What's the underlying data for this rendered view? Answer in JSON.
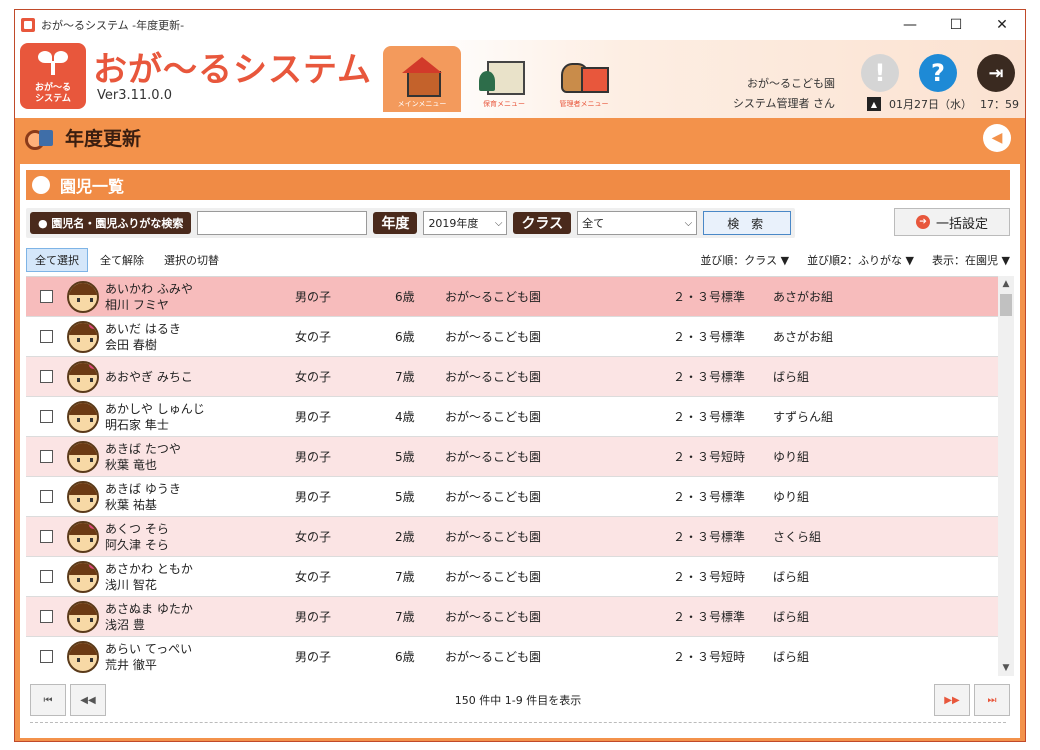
{
  "window": {
    "title": "おが～るシステム -年度更新-",
    "min": "—",
    "max": "☐",
    "close": "✕"
  },
  "header": {
    "logo_text": "おが～る\nシステム",
    "brand": "おが～るシステム",
    "version": "Ver3.11.0.0",
    "menus": [
      {
        "label": "メインメニュー",
        "icon": "house-icon"
      },
      {
        "label": "保育メニュー",
        "icon": "board-icon"
      },
      {
        "label": "管理者メニュー",
        "icon": "cat-icon"
      }
    ],
    "org": "おが～るこども園",
    "user": "システム管理者 さん",
    "date": "01月27日（水）",
    "time": "17：59"
  },
  "section": {
    "title": "年度更新"
  },
  "list": {
    "title": "園児一覧",
    "search_label": "● 園児名・園児ふりがな検索",
    "search_value": "",
    "year_label": "年度",
    "year_value": "2019年度",
    "class_label": "クラス",
    "class_value": "全て",
    "search_button": "検 索",
    "bulk_button": "一括設定"
  },
  "toolbar": {
    "select_all": "全て選択",
    "deselect_all": "全て解除",
    "toggle": "選択の切替",
    "sort1": "並び順：クラス ▼",
    "sort2": "並び順2：ふりがな ▼",
    "display": "表示：在園児 ▼"
  },
  "rows": [
    {
      "kana": "あいかわ ふみや",
      "kanji": "相川 フミヤ",
      "sex": "男の子",
      "age": "6歳",
      "org": "おが～るこども園",
      "std": "２・３号標準",
      "cls": "あさがお組",
      "girl": false
    },
    {
      "kana": "あいだ はるき",
      "kanji": "会田 春樹",
      "sex": "女の子",
      "age": "6歳",
      "org": "おが～るこども園",
      "std": "２・３号標準",
      "cls": "あさがお組",
      "girl": true
    },
    {
      "kana": "あおやぎ みちこ",
      "kanji": "",
      "sex": "女の子",
      "age": "7歳",
      "org": "おが～るこども園",
      "std": "２・３号標準",
      "cls": "ばら組",
      "girl": true
    },
    {
      "kana": "あかしや しゅんじ",
      "kanji": "明石家 隼士",
      "sex": "男の子",
      "age": "4歳",
      "org": "おが～るこども園",
      "std": "２・３号標準",
      "cls": "すずらん組",
      "girl": false
    },
    {
      "kana": "あきば たつや",
      "kanji": "秋葉 竜也",
      "sex": "男の子",
      "age": "5歳",
      "org": "おが～るこども園",
      "std": "２・３号短時",
      "cls": "ゆり組",
      "girl": false
    },
    {
      "kana": "あきば ゆうき",
      "kanji": "秋葉 祐基",
      "sex": "男の子",
      "age": "5歳",
      "org": "おが～るこども園",
      "std": "２・３号標準",
      "cls": "ゆり組",
      "girl": false
    },
    {
      "kana": "あくつ そら",
      "kanji": "阿久津 そら",
      "sex": "女の子",
      "age": "2歳",
      "org": "おが～るこども園",
      "std": "２・３号標準",
      "cls": "さくら組",
      "girl": true
    },
    {
      "kana": "あさかわ ともか",
      "kanji": "浅川 智花",
      "sex": "女の子",
      "age": "7歳",
      "org": "おが～るこども園",
      "std": "２・３号短時",
      "cls": "ばら組",
      "girl": true
    },
    {
      "kana": "あさぬま ゆたか",
      "kanji": "浅沼 豊",
      "sex": "男の子",
      "age": "7歳",
      "org": "おが～るこども園",
      "std": "２・３号標準",
      "cls": "ばら組",
      "girl": false
    },
    {
      "kana": "あらい てっぺい",
      "kanji": "荒井 徹平",
      "sex": "男の子",
      "age": "6歳",
      "org": "おが～るこども園",
      "std": "２・３号短時",
      "cls": "ばら組",
      "girl": false
    }
  ],
  "pager": {
    "first": "⏮",
    "prev": "◀◀",
    "next": "▶▶",
    "last": "⏭",
    "info": "150 件中 1-9 件目を表示"
  },
  "colors": {
    "accent": "#e8573c",
    "frame": "#f3924b",
    "selected_row": "#f7bcbc",
    "alt_row": "#fbe4e4"
  }
}
